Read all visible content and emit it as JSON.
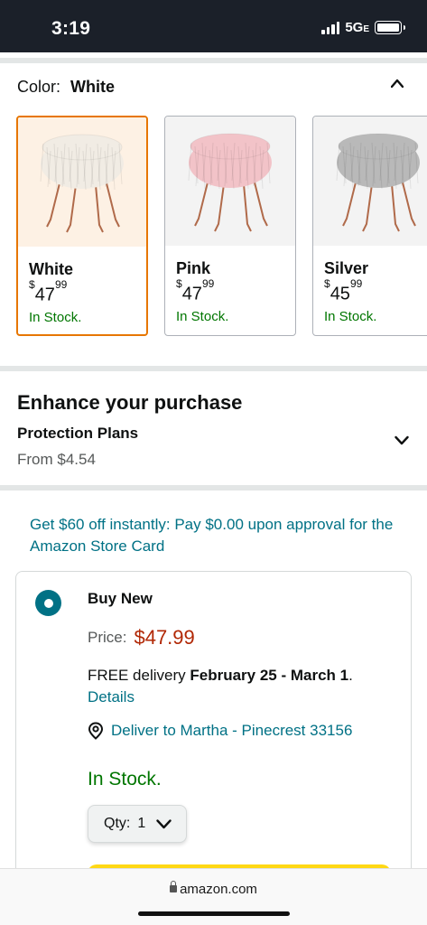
{
  "status_bar": {
    "time": "3:19",
    "network": "5G",
    "network_suffix": "E"
  },
  "color_selector": {
    "label": "Color:",
    "selected": "White",
    "options": [
      {
        "name": "White",
        "price_whole": "47",
        "price_fraction": "99",
        "currency": "$",
        "stock": "In Stock.",
        "fur_color": "#f1ece4",
        "selected": true
      },
      {
        "name": "Pink",
        "price_whole": "47",
        "price_fraction": "99",
        "currency": "$",
        "stock": "In Stock.",
        "fur_color": "#f2c3c8",
        "selected": false
      },
      {
        "name": "Silver",
        "price_whole": "45",
        "price_fraction": "99",
        "currency": "$",
        "stock": "In Stock.",
        "fur_color": "#b9b9b9",
        "selected": false
      }
    ]
  },
  "enhance": {
    "title": "Enhance your purchase",
    "plan_title": "Protection Plans",
    "plan_price": "From $4.54"
  },
  "promo": {
    "text": "Get $60 off instantly: Pay $0.00 upon approval for the Amazon Store Card"
  },
  "buy_box": {
    "option_label": "Buy New",
    "price_label": "Price:",
    "price": "$47.99",
    "delivery_prefix": "FREE delivery ",
    "delivery_dates": "February 25 - March 1",
    "delivery_suffix": ".",
    "details_link": "Details",
    "deliver_to": "Deliver to Martha - Pinecrest 33156",
    "stock": "In Stock.",
    "qty_label": "Qty:",
    "qty_value": "1"
  },
  "browser": {
    "url": "amazon.com"
  },
  "colors": {
    "link": "#007185",
    "price": "#b12704",
    "stock": "#007600",
    "selected_border": "#e77600",
    "add_to_cart": "#ffd814"
  }
}
